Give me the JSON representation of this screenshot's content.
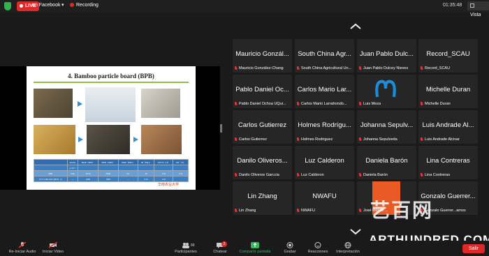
{
  "topbar": {
    "live_label": "LIVE",
    "stream_target": "en Facebook",
    "recording_label": "Recording",
    "clock": "01:35:48",
    "view_label": "Vista"
  },
  "slide": {
    "title": "4. Bamboo particle board (BPB)",
    "table": {
      "header": [
        "",
        "density",
        "MOR（MPa）",
        "MOR（MPa）",
        "MOE（MPa）",
        "IB（Mpa）",
        "24h TS（%）",
        "MC（%）"
      ],
      "units": [
        "",
        "g·cm⁻³",
        "",
        "",
        "",
        "",
        "",
        ""
      ],
      "row_bpb": [
        "BPB",
        "0.88",
        "28.50",
        "28.80",
        "62",
        "62",
        "12.9",
        "5.74"
      ],
      "row_std": [
        "LY/T 1380-2010 (FKB · 2)",
        "—",
        "2280",
        "1800",
        "—",
        "0.35",
        "15.0",
        ""
      ]
    },
    "signature": "华南农业大学"
  },
  "participants": [
    {
      "display": "Mauricio Gonzál...",
      "label": "Mauricio González-Chang"
    },
    {
      "display": "South China Agr...",
      "label": "South China Agricultural Un..."
    },
    {
      "display": "Juan Pablo Dulc...",
      "label": "Juan Pablo Dulcey Nieves"
    },
    {
      "display": "Record_SCAU",
      "label": "Record_SCAU"
    },
    {
      "display": "Pablo Daniel Oc...",
      "label": "Pablo Daniel Ochoa UQui..."
    },
    {
      "display": "Carlos Mario Lar...",
      "label": "Carlos Mario Larrahondo..."
    },
    {
      "display": "",
      "label": "Luis Meza"
    },
    {
      "display": "Michelle Duran",
      "label": "Michelle Duran"
    },
    {
      "display": "Carlos Gutierrez",
      "label": "Carlos Gutierrez"
    },
    {
      "display": "Holmes Rodrígu...",
      "label": "Holmes Rodriguez"
    },
    {
      "display": "Johanna  Sepulv...",
      "label": "Johanna  Sepulveda"
    },
    {
      "display": "Luis Andrade Al...",
      "label": "Luis Andrade Alcivar"
    },
    {
      "display": "Danilo Oliveros...",
      "label": "Danilo Oliveros Garccia"
    },
    {
      "display": "Luz Calderon",
      "label": "Luz Calderon"
    },
    {
      "display": "Daniela Barón",
      "label": "Daniela Barón"
    },
    {
      "display": "Lina Contreras",
      "label": "Lina Contreras"
    },
    {
      "display": "Lin Zhang",
      "label": "Lin Zhang"
    },
    {
      "display": "NWAFU",
      "label": "NWAFU"
    },
    {
      "display": "",
      "label": "José Miguel ..."
    },
    {
      "display": "Gonzalo Guerrer...",
      "label": "Gonzalo Guerrer...amos"
    }
  ],
  "watermark": {
    "logo_text": "艺百网",
    "url": "ARTHUNDRED.COM"
  },
  "toolbar": {
    "audio": "Re-Iniciar Audio",
    "video": "Iniciar Video",
    "participants": "Participantes",
    "participants_count": "88",
    "chat": "Chatear",
    "chat_badge": "2",
    "share": "Compartir pantalla",
    "record": "Grabar",
    "reactions": "Reacciones",
    "interpretation": "Interpretación",
    "leave": "Salir"
  },
  "colors": {
    "live": "#e02828",
    "accent_green": "#2dbb5a",
    "tile": "#262626"
  }
}
